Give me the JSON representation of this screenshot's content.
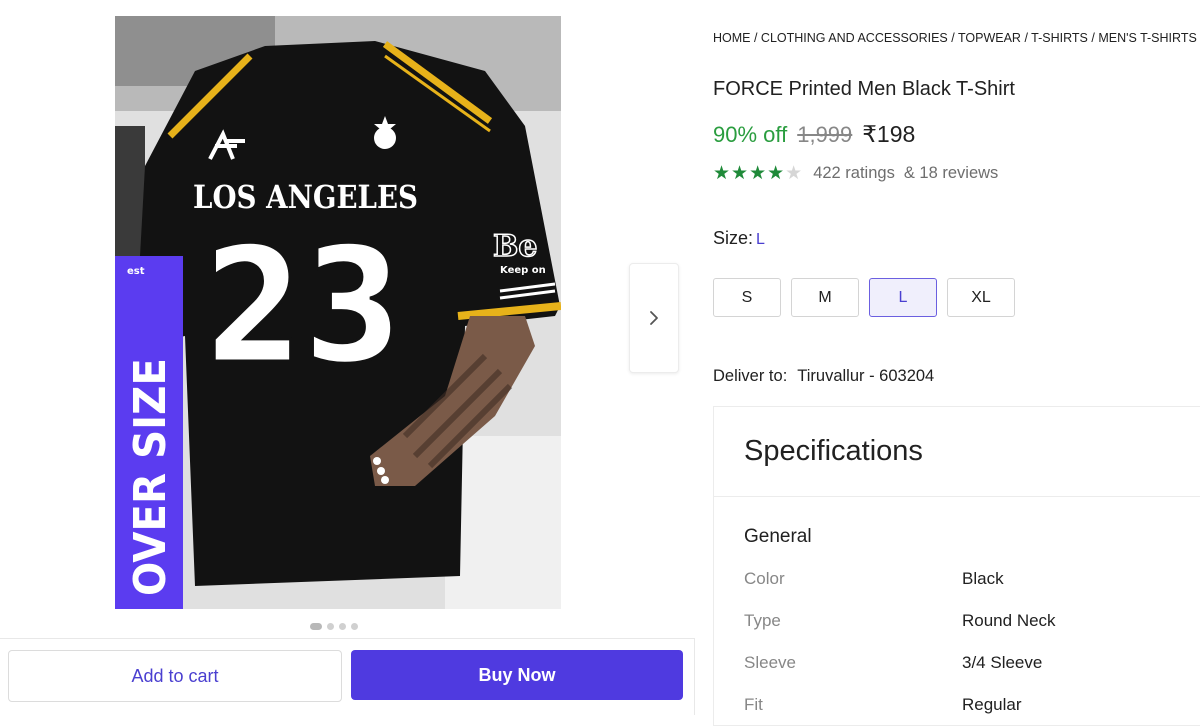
{
  "product_image": {
    "overlay_label": "OVER SIZE",
    "shirt_text": "LOS ANGELES",
    "shirt_number": "23",
    "sleeve_text": "Be",
    "sleeve_subtext": "Keep on",
    "left_sleeve_text": "est"
  },
  "carousel": {
    "dots": 4,
    "active_dot": 0
  },
  "actions": {
    "add_to_cart": "Add to cart",
    "buy_now": "Buy Now"
  },
  "breadcrumb": [
    "HOME",
    "CLOTHING AND ACCESSORIES",
    "TOPWEAR",
    "T-SHIRTS",
    "MEN'S T-SHIRTS"
  ],
  "product": {
    "title": "FORCE Printed Men Black T-Shirt",
    "discount": "90% off",
    "mrp": "1,999",
    "price": "₹198",
    "stars_full": "★★★★",
    "stars_empty": "★",
    "rating_value": 4,
    "ratings_text": "422 ratings",
    "reviews_text": "& 18 reviews"
  },
  "size": {
    "label": "Size:",
    "selected": "L",
    "options": [
      "S",
      "M",
      "L",
      "XL"
    ]
  },
  "delivery": {
    "label": "Deliver to:",
    "location": "Tiruvallur - 603204"
  },
  "specifications": {
    "title": "Specifications",
    "group": "General",
    "rows": [
      {
        "key": "Color",
        "value": "Black"
      },
      {
        "key": "Type",
        "value": "Round Neck"
      },
      {
        "key": "Sleeve",
        "value": "3/4 Sleeve"
      },
      {
        "key": "Fit",
        "value": "Regular"
      }
    ]
  },
  "colors": {
    "brand_accent": "#4f3ae0",
    "discount_green": "#2a9d3f",
    "star_green": "#1f8a39",
    "shirt_black": "#111111",
    "stripe_yellow": "#e7b21a",
    "overlay_purple": "#5b3cf0"
  }
}
